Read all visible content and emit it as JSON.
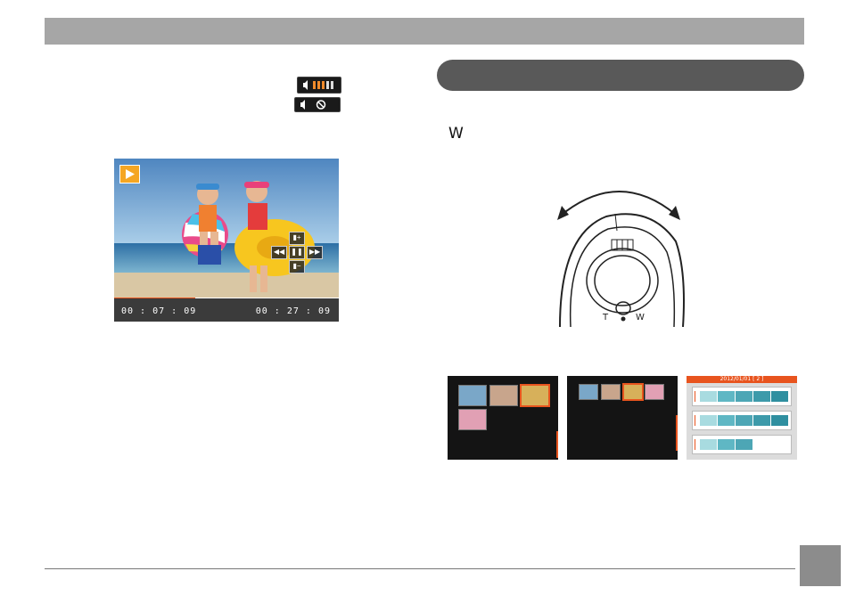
{
  "page": {
    "w_label": "W"
  },
  "video": {
    "time_elapsed": "00 : 07 : 09",
    "time_total": "00 : 27 : 09",
    "progress_fraction": 0.36,
    "controls": {
      "vol_up": "▮+",
      "rewind": "◀◀",
      "pause": "❚❚",
      "forward": "▶▶",
      "vol_down": "▮−"
    }
  },
  "dial": {
    "t_label": "T",
    "w_label": "W"
  },
  "screens": {
    "calendar_title": "2012/01/01 [ 2 ]"
  },
  "colors": {
    "accent": "#e8541e",
    "header_gray": "#a6a6a6",
    "pill_dark": "#595959",
    "cal_light": "#a8dbe0",
    "cal_mid": "#5fb7c4",
    "cal_dark": "#2f8fa0"
  }
}
